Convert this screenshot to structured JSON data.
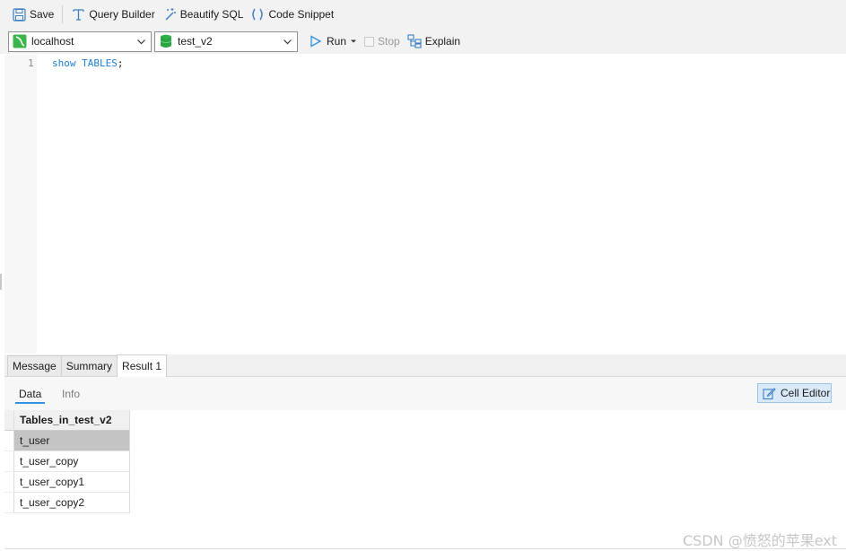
{
  "toolbar": {
    "save_label": "Save",
    "query_builder_label": "Query Builder",
    "beautify_label": "Beautify SQL",
    "snippet_label": "Code Snippet"
  },
  "connection_bar": {
    "connection": "localhost",
    "database": "test_v2",
    "run_label": "Run",
    "stop_label": "Stop",
    "explain_label": "Explain"
  },
  "editor": {
    "lines": [
      {
        "number": "1",
        "keyword": "show TABLES",
        "terminator": ";"
      }
    ]
  },
  "result_tabs": {
    "message": "Message",
    "summary": "Summary",
    "result1": "Result 1"
  },
  "data_tabs": {
    "data": "Data",
    "info": "Info",
    "cell_editor": "Cell Editor"
  },
  "grid": {
    "column": "Tables_in_test_v2",
    "rows": [
      "t_user",
      "t_user_copy",
      "t_user_copy1",
      "t_user_copy2"
    ],
    "selected_index": 0
  },
  "watermark": "CSDN @愤怒的苹果ext",
  "colors": {
    "accent": "#2f8fe0",
    "keyword": "#1b7fd4",
    "selection": "#c4c4c4",
    "cell_editor_bg": "#d9e9f8"
  }
}
